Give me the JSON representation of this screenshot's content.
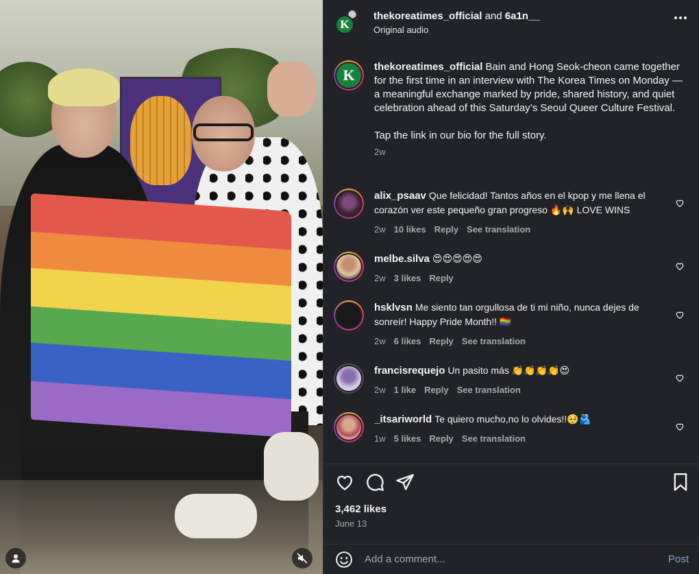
{
  "header": {
    "username": "thekoreatimes_official",
    "conjunction": "and",
    "collaborator": "6a1n__",
    "audio": "Original audio",
    "avatar_letter": "K"
  },
  "caption": {
    "username": "thekoreatimes_official",
    "text": "Bain and Hong Seok-cheon came together for the first time in an interview with The Korea Times on Monday — a meaningful exchange marked by pride, shared history, and quiet celebration ahead of this Saturday’s Seoul Queer Culture Festival.",
    "link_text": "Tap the link in our bio for the full story.",
    "time": "2w"
  },
  "comments": [
    {
      "username": "alix_psaav",
      "text": "Que felicidad! Tantos años en el kpop y me llena el corazón ver este pequeño gran progreso 🔥🙌 LOVE WINS",
      "time": "2w",
      "likes": "10 likes",
      "reply": "Reply",
      "translate": "See translation"
    },
    {
      "username": "melbe.silva",
      "text": "😍😍😍😍😍",
      "time": "2w",
      "likes": "3 likes",
      "reply": "Reply",
      "translate": ""
    },
    {
      "username": "hsklvsn",
      "text": "Me siento tan orgullosa de ti mi niño, nunca dejes de sonreír! Happy Pride Month!! 🏳️‍🌈",
      "time": "2w",
      "likes": "6 likes",
      "reply": "Reply",
      "translate": "See translation"
    },
    {
      "username": "francisrequejo",
      "text": "Un pasito más 👏👏👏👏😍",
      "time": "2w",
      "likes": "1 like",
      "reply": "Reply",
      "translate": "See translation"
    },
    {
      "username": "_itsariworld",
      "text": "Te quiero mucho,no lo olvides!!🥺🫂",
      "time": "1w",
      "likes": "5 likes",
      "reply": "Reply",
      "translate": "See translation"
    }
  ],
  "stats": {
    "likes": "3,462 likes",
    "date": "June 13"
  },
  "composer": {
    "placeholder": "Add a comment...",
    "post_label": "Post"
  },
  "icons": {
    "more": "more-horizontal-icon",
    "like": "heart-icon",
    "comment": "comment-bubble-icon",
    "share": "paper-plane-icon",
    "save": "bookmark-icon",
    "emoji": "emoji-smile-icon",
    "user": "user-tags-icon",
    "mute": "volume-muted-icon"
  },
  "colors": {
    "panel_bg": "#212328",
    "brand_green": "#17823b",
    "muted_text": "#a8a8a8",
    "post_link": "#8aa3c4"
  }
}
